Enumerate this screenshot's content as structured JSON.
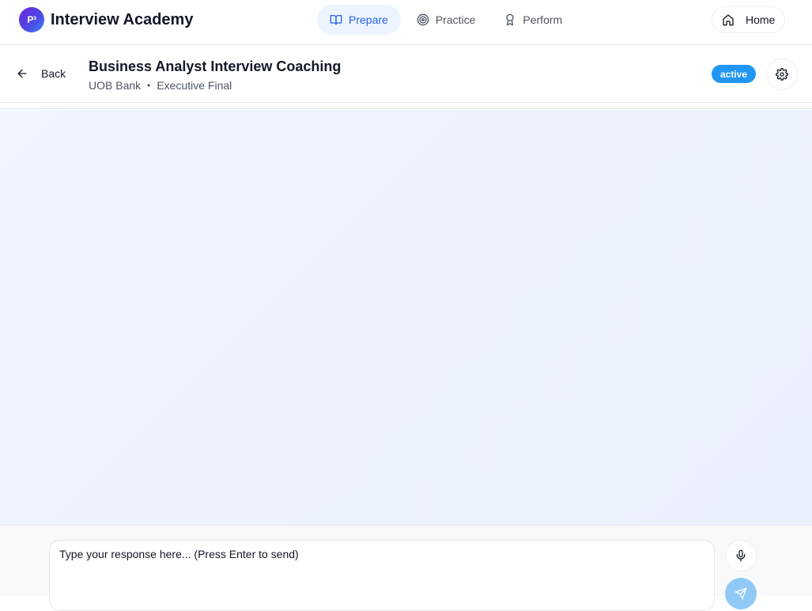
{
  "brand": {
    "logo_text": "P³",
    "title": "Interview Academy"
  },
  "nav": {
    "tabs": [
      {
        "label": "Prepare",
        "icon": "book-open-icon",
        "active": true
      },
      {
        "label": "Practice",
        "icon": "target-icon",
        "active": false
      },
      {
        "label": "Perform",
        "icon": "award-icon",
        "active": false
      }
    ],
    "home_label": "Home"
  },
  "session": {
    "back_label": "Back",
    "title": "Business Analyst Interview Coaching",
    "company": "UOB Bank",
    "separator": "•",
    "stage": "Executive Final",
    "status": "active"
  },
  "composer": {
    "placeholder": "Type your response here... (Press Enter to send)",
    "value": ""
  },
  "colors": {
    "accent": "#2563eb",
    "active_tab_bg": "#eef4ff",
    "status_badge": "#2196f3",
    "send_button": "#90c9f5",
    "chat_bg": "#eef2fd"
  }
}
